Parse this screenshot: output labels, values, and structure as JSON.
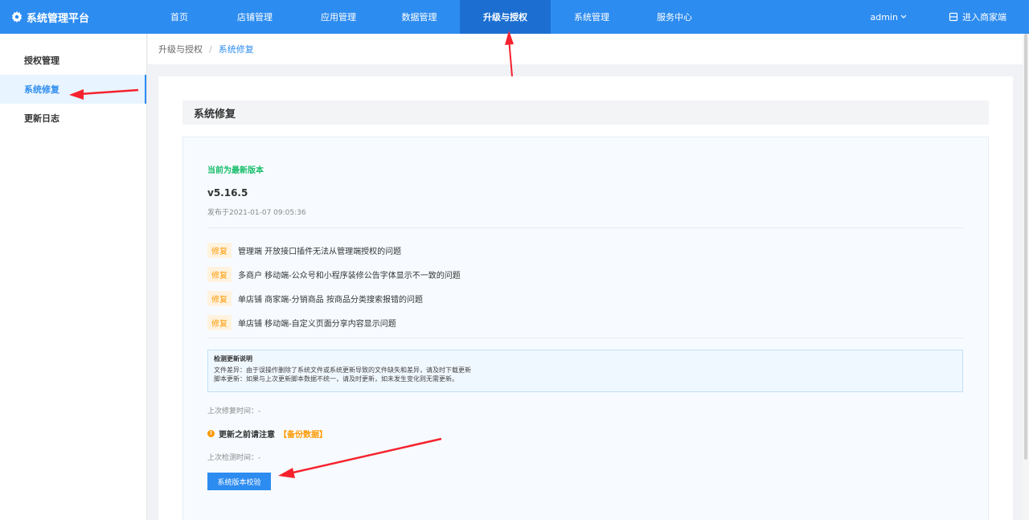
{
  "header": {
    "brand": "系统管理平台",
    "nav": [
      "首页",
      "店铺管理",
      "应用管理",
      "数据管理",
      "升级与授权",
      "系统管理",
      "服务中心"
    ],
    "active_nav": "升级与授权",
    "user": "admin",
    "enter_store": "进入商家端"
  },
  "sidebar": {
    "items": [
      "授权管理",
      "系统修复",
      "更新日志"
    ],
    "active": "系统修复"
  },
  "breadcrumb": {
    "parent": "升级与授权",
    "separator": "/",
    "current": "系统修复"
  },
  "main": {
    "section_title": "系统修复",
    "status": "当前为最新版本",
    "version": "v5.16.5",
    "released": "发布于2021-01-07 09:05:36",
    "fixes": [
      {
        "tag": "修复",
        "text": "管理端 开放接口插件无法从管理端授权的问题"
      },
      {
        "tag": "修复",
        "text": "多商户 移动端-公众号和小程序装修公告字体显示不一致的问题"
      },
      {
        "tag": "修复",
        "text": "单店铺 商家端-分销商品 按商品分类搜索报错的问题"
      },
      {
        "tag": "修复",
        "text": "单店铺 移动端-自定义页面分享内容显示问题"
      }
    ],
    "note": {
      "title": "检测更新说明",
      "line1": "文件差异：由于误操作删除了系统文件或系统更新导致的文件缺失和差异，请及时下载更新",
      "line2": "脚本更新：如果与上次更新脚本数据不统一，请及时更新，如未发生变化则无需更新。"
    },
    "last_fix": "上次修复时间：-",
    "warning": "更新之前请注意",
    "backup": "【备份数据】",
    "last_check": "上次检测时间：-",
    "verify_button": "系统版本校验"
  },
  "colors": {
    "primary": "#2d8cf0",
    "success": "#19be6b",
    "warning": "#ff9900",
    "annotation": "#f5222d"
  }
}
